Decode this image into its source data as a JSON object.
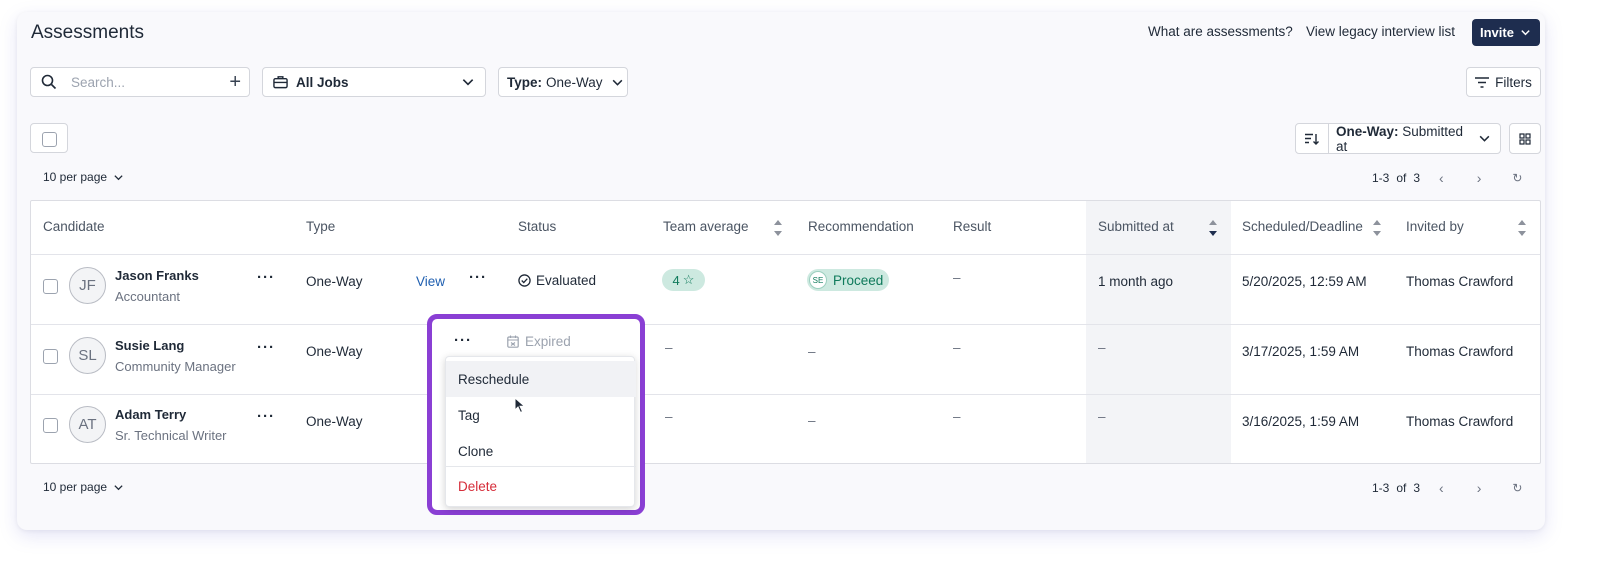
{
  "header": {
    "title": "Assessments",
    "link_what": "What are assessments?",
    "link_legacy": "View legacy interview list",
    "invite_label": "Invite"
  },
  "toolbar": {
    "search_placeholder": "Search...",
    "jobs_label": "All Jobs",
    "type_prefix": "Type:",
    "type_value": "One-Way",
    "filters_label": "Filters"
  },
  "sort": {
    "prefix": "One-Way:",
    "value": "Submitted at"
  },
  "pagination": {
    "per_page": "10 per page",
    "range": "1-3",
    "of": "of",
    "total": "3"
  },
  "table": {
    "columns": [
      "Candidate",
      "Type",
      "Status",
      "Team average",
      "Recommendation",
      "Result",
      "Submitted at",
      "Scheduled/Deadline",
      "Invited by"
    ],
    "rows": [
      {
        "initials": "JF",
        "name": "Jason Franks",
        "role": "Accountant",
        "type": "One-Way",
        "view": "View",
        "status": "Evaluated",
        "team_avg": "4",
        "rec_badge": "SE",
        "recommendation": "Proceed",
        "result": "–",
        "submitted": "1 month ago",
        "deadline": "5/20/2025, 12:59 AM",
        "invited_by": "Thomas Crawford"
      },
      {
        "initials": "SL",
        "name": "Susie Lang",
        "role": "Community Manager",
        "type": "One-Way",
        "status": "Expired",
        "team_avg": "–",
        "recommendation": "–",
        "result": "–",
        "submitted": "–",
        "deadline": "3/17/2025, 1:59 AM",
        "invited_by": "Thomas Crawford"
      },
      {
        "initials": "AT",
        "name": "Adam Terry",
        "role": "Sr. Technical Writer",
        "type": "One-Way",
        "team_avg": "–",
        "recommendation": "–",
        "result": "–",
        "submitted": "–",
        "deadline": "3/16/2025, 1:59 AM",
        "invited_by": "Thomas Crawford"
      }
    ]
  },
  "context_menu": {
    "items": [
      "Reschedule",
      "Tag",
      "Clone",
      "Delete"
    ]
  },
  "colors": {
    "invite_bg": "#1e2d4f",
    "highlight": "#8a3fd4",
    "pill_bg": "#cde9e0",
    "pill_text": "#0f7a5b",
    "delete": "#d62d3a"
  }
}
